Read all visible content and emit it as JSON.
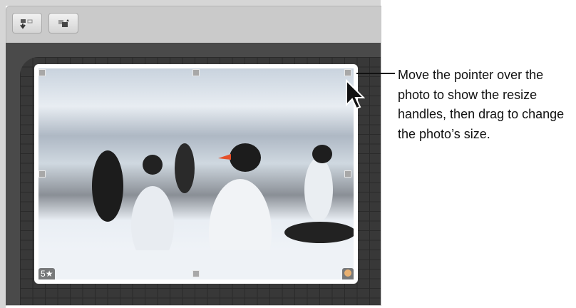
{
  "toolbar": {
    "buttons": [
      {
        "name": "import-button",
        "icon": "import-icon"
      },
      {
        "name": "arrange-button",
        "icon": "arrange-icon"
      }
    ]
  },
  "photo": {
    "rating": "5",
    "rating_icon": "star-icon",
    "corner_icon": "photo-badge-icon"
  },
  "callout": {
    "text": "Move the pointer over the photo to show the resize handles, then drag to change the photo’s size."
  }
}
